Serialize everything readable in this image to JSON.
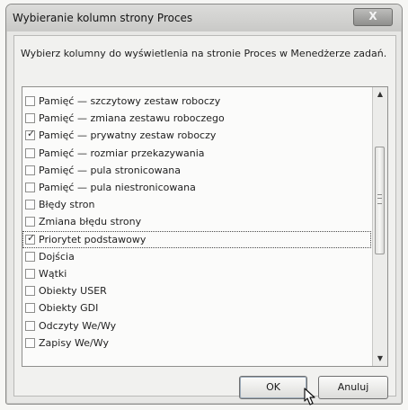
{
  "window": {
    "title": "Wybieranie kolumn strony Proces",
    "close_label": "X"
  },
  "instructions": "Wybierz kolumny do wyświetlenia na stronie Proces w Menedżerze zadań.",
  "columns": [
    {
      "label": "Pamięć — szczytowy zestaw roboczy",
      "checked": false
    },
    {
      "label": "Pamięć — zmiana zestawu roboczego",
      "checked": false
    },
    {
      "label": "Pamięć — prywatny zestaw roboczy",
      "checked": true
    },
    {
      "label": "Pamięć — rozmiar przekazywania",
      "checked": false
    },
    {
      "label": "Pamięć — pula stronicowana",
      "checked": false
    },
    {
      "label": "Pamięć — pula niestronicowana",
      "checked": false
    },
    {
      "label": "Błędy stron",
      "checked": false
    },
    {
      "label": "Zmiana błędu strony",
      "checked": false
    },
    {
      "label": "Priorytet podstawowy",
      "checked": true,
      "focused": true
    },
    {
      "label": "Dojścia",
      "checked": false
    },
    {
      "label": "Wątki",
      "checked": false
    },
    {
      "label": "Obiekty USER",
      "checked": false
    },
    {
      "label": "Obiekty GDI",
      "checked": false
    },
    {
      "label": "Odczyty We/Wy",
      "checked": false
    },
    {
      "label": "Zapisy We/Wy",
      "checked": false
    }
  ],
  "buttons": {
    "ok": "OK",
    "cancel": "Anuluj"
  }
}
